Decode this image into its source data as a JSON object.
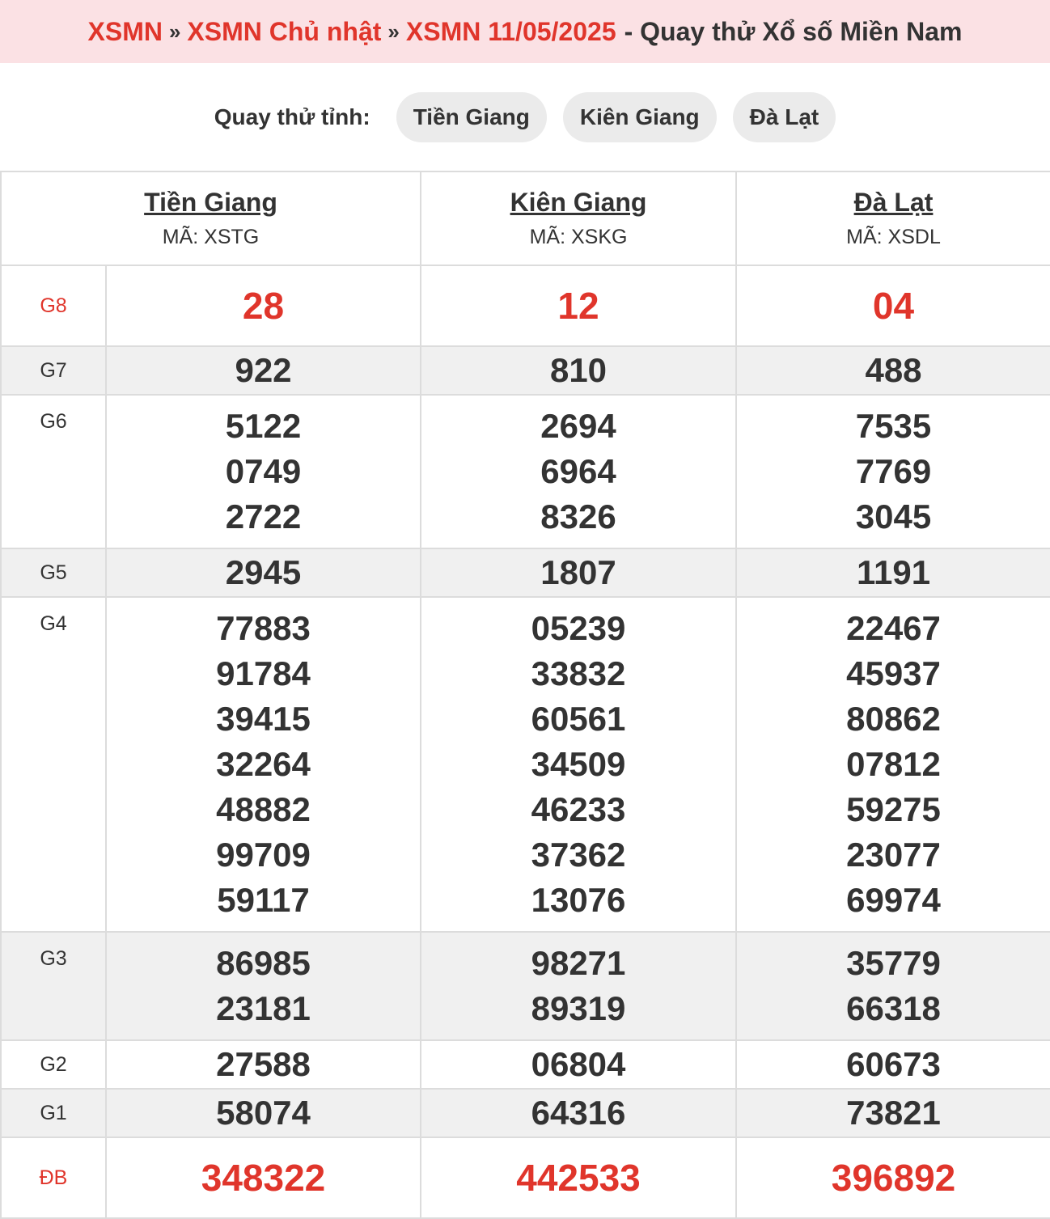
{
  "header": {
    "crumb1": "XSMN",
    "sep": "»",
    "crumb2": "XSMN Chủ nhật",
    "crumb3": "XSMN 11/05/2025",
    "rest": "- Quay thử Xổ số Miền Nam"
  },
  "selector": {
    "label": "Quay thử tỉnh:",
    "options": [
      "Tiền Giang",
      "Kiên Giang",
      "Đà Lạt"
    ]
  },
  "provinces": [
    {
      "name": "Tiền Giang",
      "code": "MÃ: XSTG"
    },
    {
      "name": "Kiên Giang",
      "code": "MÃ: XSKG"
    },
    {
      "name": "Đà Lạt",
      "code": "MÃ: XSDL"
    }
  ],
  "prizes": [
    {
      "label": "G8",
      "values": [
        [
          "28"
        ],
        [
          "12"
        ],
        [
          "04"
        ]
      ]
    },
    {
      "label": "G7",
      "values": [
        [
          "922"
        ],
        [
          "810"
        ],
        [
          "488"
        ]
      ]
    },
    {
      "label": "G6",
      "values": [
        [
          "5122",
          "0749",
          "2722"
        ],
        [
          "2694",
          "6964",
          "8326"
        ],
        [
          "7535",
          "7769",
          "3045"
        ]
      ]
    },
    {
      "label": "G5",
      "values": [
        [
          "2945"
        ],
        [
          "1807"
        ],
        [
          "1191"
        ]
      ]
    },
    {
      "label": "G4",
      "values": [
        [
          "77883",
          "91784",
          "39415",
          "32264",
          "48882",
          "99709",
          "59117"
        ],
        [
          "05239",
          "33832",
          "60561",
          "34509",
          "46233",
          "37362",
          "13076"
        ],
        [
          "22467",
          "45937",
          "80862",
          "07812",
          "59275",
          "23077",
          "69974"
        ]
      ]
    },
    {
      "label": "G3",
      "values": [
        [
          "86985",
          "23181"
        ],
        [
          "98271",
          "89319"
        ],
        [
          "35779",
          "66318"
        ]
      ]
    },
    {
      "label": "G2",
      "values": [
        [
          "27588"
        ],
        [
          "06804"
        ],
        [
          "60673"
        ]
      ]
    },
    {
      "label": "G1",
      "values": [
        [
          "58074"
        ],
        [
          "64316"
        ],
        [
          "73821"
        ]
      ]
    },
    {
      "label": "ĐB",
      "values": [
        [
          "348322"
        ],
        [
          "442533"
        ],
        [
          "396892"
        ]
      ]
    }
  ],
  "colors": {
    "accent": "#e0352b",
    "header_bg": "#fbe1e4",
    "alt_row": "#f0f0f0",
    "pill_bg": "#ebebeb"
  }
}
